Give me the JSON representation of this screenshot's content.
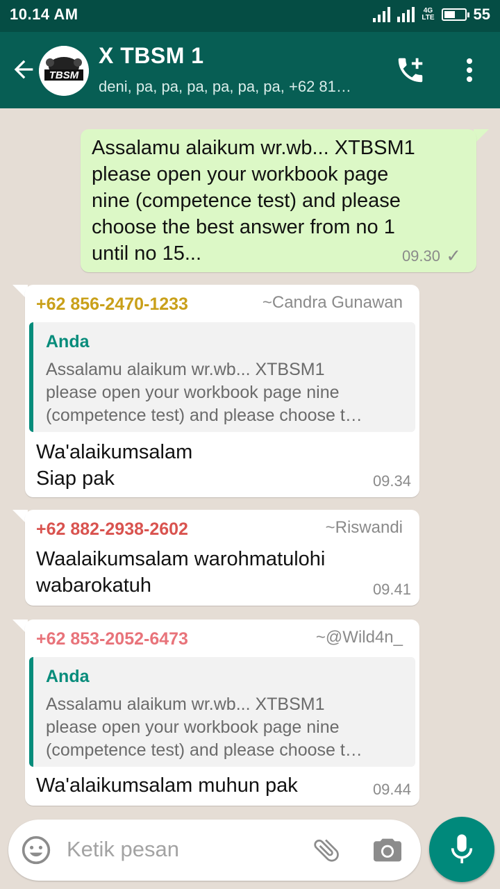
{
  "status_bar": {
    "time": "10.14 AM",
    "network": "4G",
    "network_sub": "LTE",
    "battery": "55",
    "battery_level": 0.55
  },
  "header": {
    "title": "X TBSM 1",
    "subtitle": "deni, pa, pa, pa, pa, pa, pa, +62 81…",
    "avatar_text": "TBSM",
    "icons": [
      "back-arrow-icon",
      "add-call-icon",
      "more-vert-icon"
    ]
  },
  "messages": [
    {
      "type": "outgoing",
      "text_lines": [
        "Assalamu alaikum wr.wb...  XTBSM1",
        "please open your workbook page",
        "nine (competence test) and please",
        "choose the best answer from no 1",
        "until no 15..."
      ],
      "time": "09.30",
      "status": "✓"
    },
    {
      "type": "incoming",
      "sender": "+62 856-2470-1233",
      "sender_color": "#c9a01a",
      "alias": "~Candra Gunawan",
      "quote": {
        "author": "Anda",
        "lines": [
          "Assalamu alaikum wr.wb...  XTBSM1",
          "please open your workbook page nine",
          "(competence test) and please choose t…"
        ]
      },
      "text_lines": [
        "Wa'alaikumsalam",
        "Siap pak"
      ],
      "time": "09.34"
    },
    {
      "type": "incoming",
      "sender": "+62 882-2938-2602",
      "sender_color": "#d9534f",
      "alias": "~Riswandi",
      "text_lines": [
        "Waalaikumsalam warohmatulohi",
        "wabarokatuh"
      ],
      "time": "09.41"
    },
    {
      "type": "incoming",
      "sender": "+62 853-2052-6473",
      "sender_color": "#e8737a",
      "alias": "~@Wild4n_",
      "quote": {
        "author": "Anda",
        "lines": [
          "Assalamu alaikum wr.wb...  XTBSM1",
          "please open your workbook page nine",
          "(competence test) and please choose t…"
        ]
      },
      "text_lines": [
        "Wa'alaikumsalam muhun pak"
      ],
      "time": "09.44"
    }
  ],
  "composer": {
    "placeholder": "Ketik pesan",
    "icons": [
      "emoji-icon",
      "attach-icon",
      "camera-icon",
      "mic-icon"
    ]
  },
  "colors": {
    "header": "#075e54",
    "status_bar": "#054d44",
    "outgoing_bubble": "#dcf8c6",
    "quote_accent": "#078c7b",
    "fab": "#00897b"
  }
}
